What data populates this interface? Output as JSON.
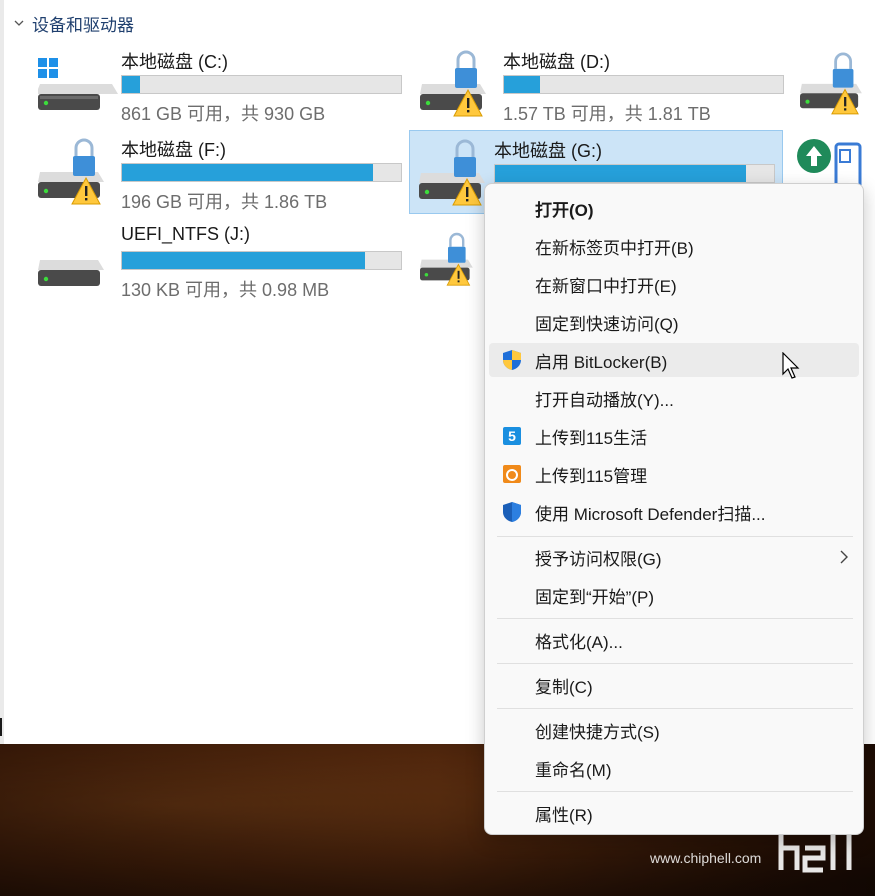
{
  "section": {
    "title": "设备和驱动器"
  },
  "drives": [
    {
      "name": "本地磁盘 (C:)",
      "space": "861 GB 可用，共 930 GB",
      "usage": 0.07
    },
    {
      "name": "本地磁盘 (D:)",
      "space": "1.57 TB 可用，共 1.81 TB",
      "usage": 0.13
    },
    {
      "name": "本地磁盘 (F:)",
      "space": "196 GB 可用，共 1.86 TB",
      "usage": 0.9
    },
    {
      "name": "本地磁盘 (G:)",
      "usage": 0.9
    },
    {
      "name": "UEFI_NTFS (J:)",
      "space": "130 KB 可用，共 0.98 MB",
      "usage": 0.87
    }
  ],
  "context_menu": {
    "items": [
      {
        "label": "打开(O)",
        "bold": true
      },
      {
        "label": "在新标签页中打开(B)"
      },
      {
        "label": "在新窗口中打开(E)"
      },
      {
        "label": "固定到快速访问(Q)"
      },
      {
        "label": "启用 BitLocker(B)",
        "icon": "shield-icon",
        "hover": true
      },
      {
        "label": "打开自动播放(Y)..."
      },
      {
        "label": "上传到115生活",
        "icon": "115-life-icon"
      },
      {
        "label": "上传到115管理",
        "icon": "115-manage-icon"
      },
      {
        "label": "使用 Microsoft Defender扫描...",
        "icon": "defender-icon"
      },
      {
        "label": "授予访问权限(G)",
        "submenu": true
      },
      {
        "label": "固定到“开始”(P)"
      },
      {
        "label": "格式化(A)..."
      },
      {
        "label": "复制(C)"
      },
      {
        "label": "创建快捷方式(S)"
      },
      {
        "label": "重命名(M)"
      },
      {
        "label": "属性(R)"
      }
    ]
  },
  "watermark": {
    "url": "www.chiphell.com",
    "logo_text": "chip hell"
  },
  "colors": {
    "accent": "#26a0da",
    "selection": "#cce4f7",
    "warning": "#ffc83d"
  }
}
